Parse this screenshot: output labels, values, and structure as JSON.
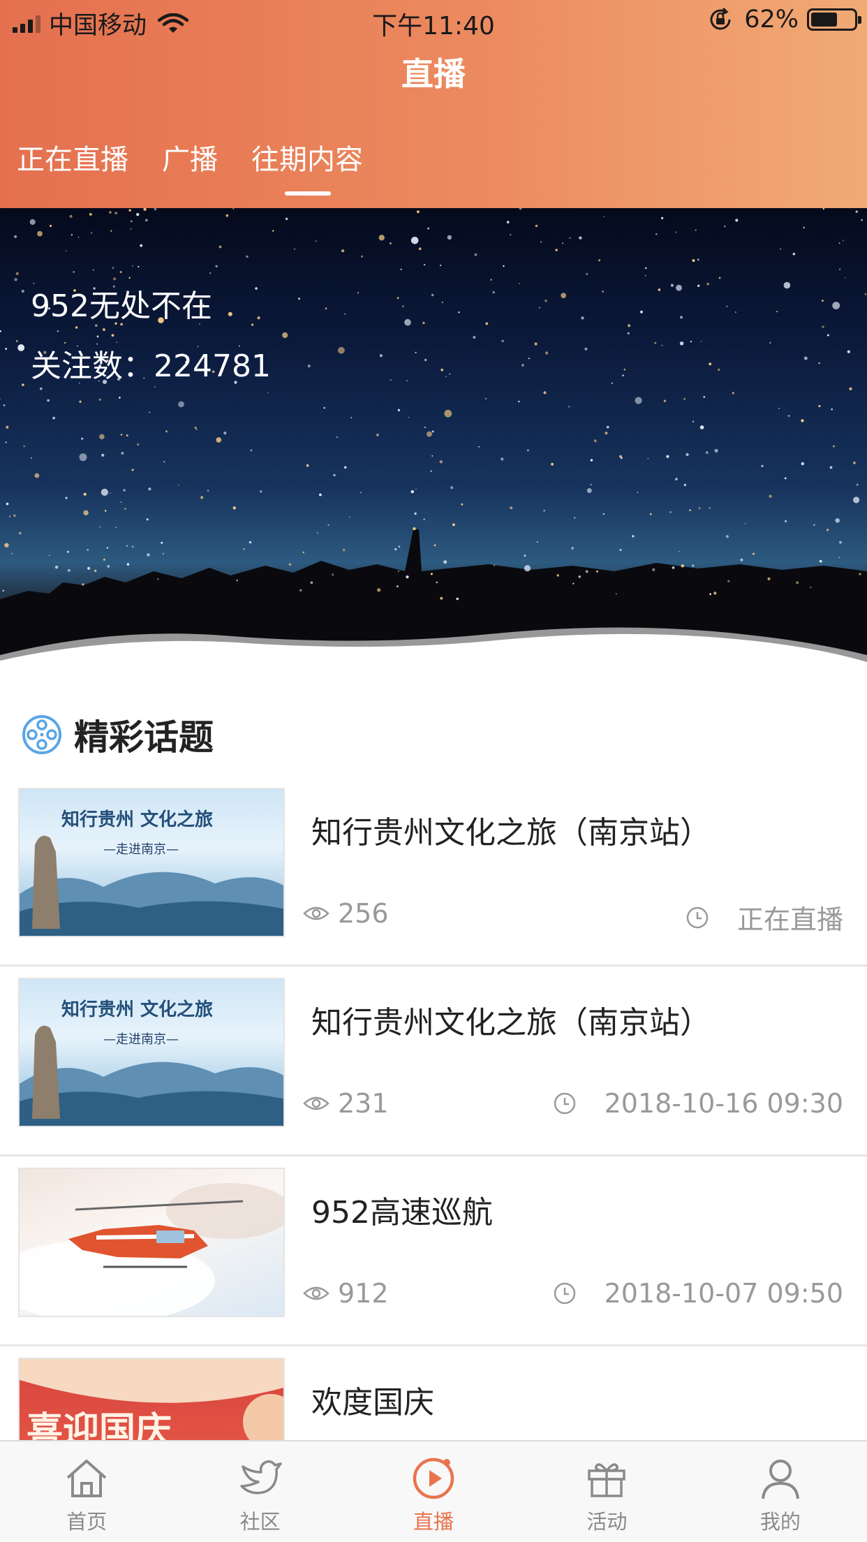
{
  "status_bar": {
    "carrier": "中国移动",
    "time": "下午11:40",
    "battery_percent": "62%",
    "battery_level": 0.62
  },
  "header": {
    "title": "直播",
    "tabs": [
      {
        "label": "正在直播",
        "active": false
      },
      {
        "label": "广播",
        "active": false
      },
      {
        "label": "往期内容",
        "active": true
      }
    ],
    "gradient_start": "#e4704f",
    "gradient_end": "#f1aa74"
  },
  "banner": {
    "name": "952无处不在",
    "followers": "关注数：224781"
  },
  "section": {
    "title": "精彩话题",
    "icon": "film-reel-icon"
  },
  "topics": [
    {
      "title": "知行贵州文化之旅（南京站）",
      "views": "256",
      "time": "正在直播",
      "thumb_caption": "—走进南京—"
    },
    {
      "title": "知行贵州文化之旅（南京站）",
      "views": "231",
      "time": "2018-10-16 09:30",
      "thumb_caption": "—走进南京—"
    },
    {
      "title": "952高速巡航",
      "views": "912",
      "time": "2018-10-07 09:50"
    },
    {
      "title": "欢度国庆",
      "thumb_caption": "喜迎国庆"
    }
  ],
  "bottom_nav": {
    "items": [
      {
        "label": "首页",
        "icon": "home-icon",
        "active": false
      },
      {
        "label": "社区",
        "icon": "bird-icon",
        "active": false
      },
      {
        "label": "直播",
        "icon": "play-icon",
        "active": true
      },
      {
        "label": "活动",
        "icon": "gift-icon",
        "active": false
      },
      {
        "label": "我的",
        "icon": "user-icon",
        "active": false
      }
    ],
    "active_color": "#e8744f",
    "inactive_color": "#8a8a8a"
  }
}
